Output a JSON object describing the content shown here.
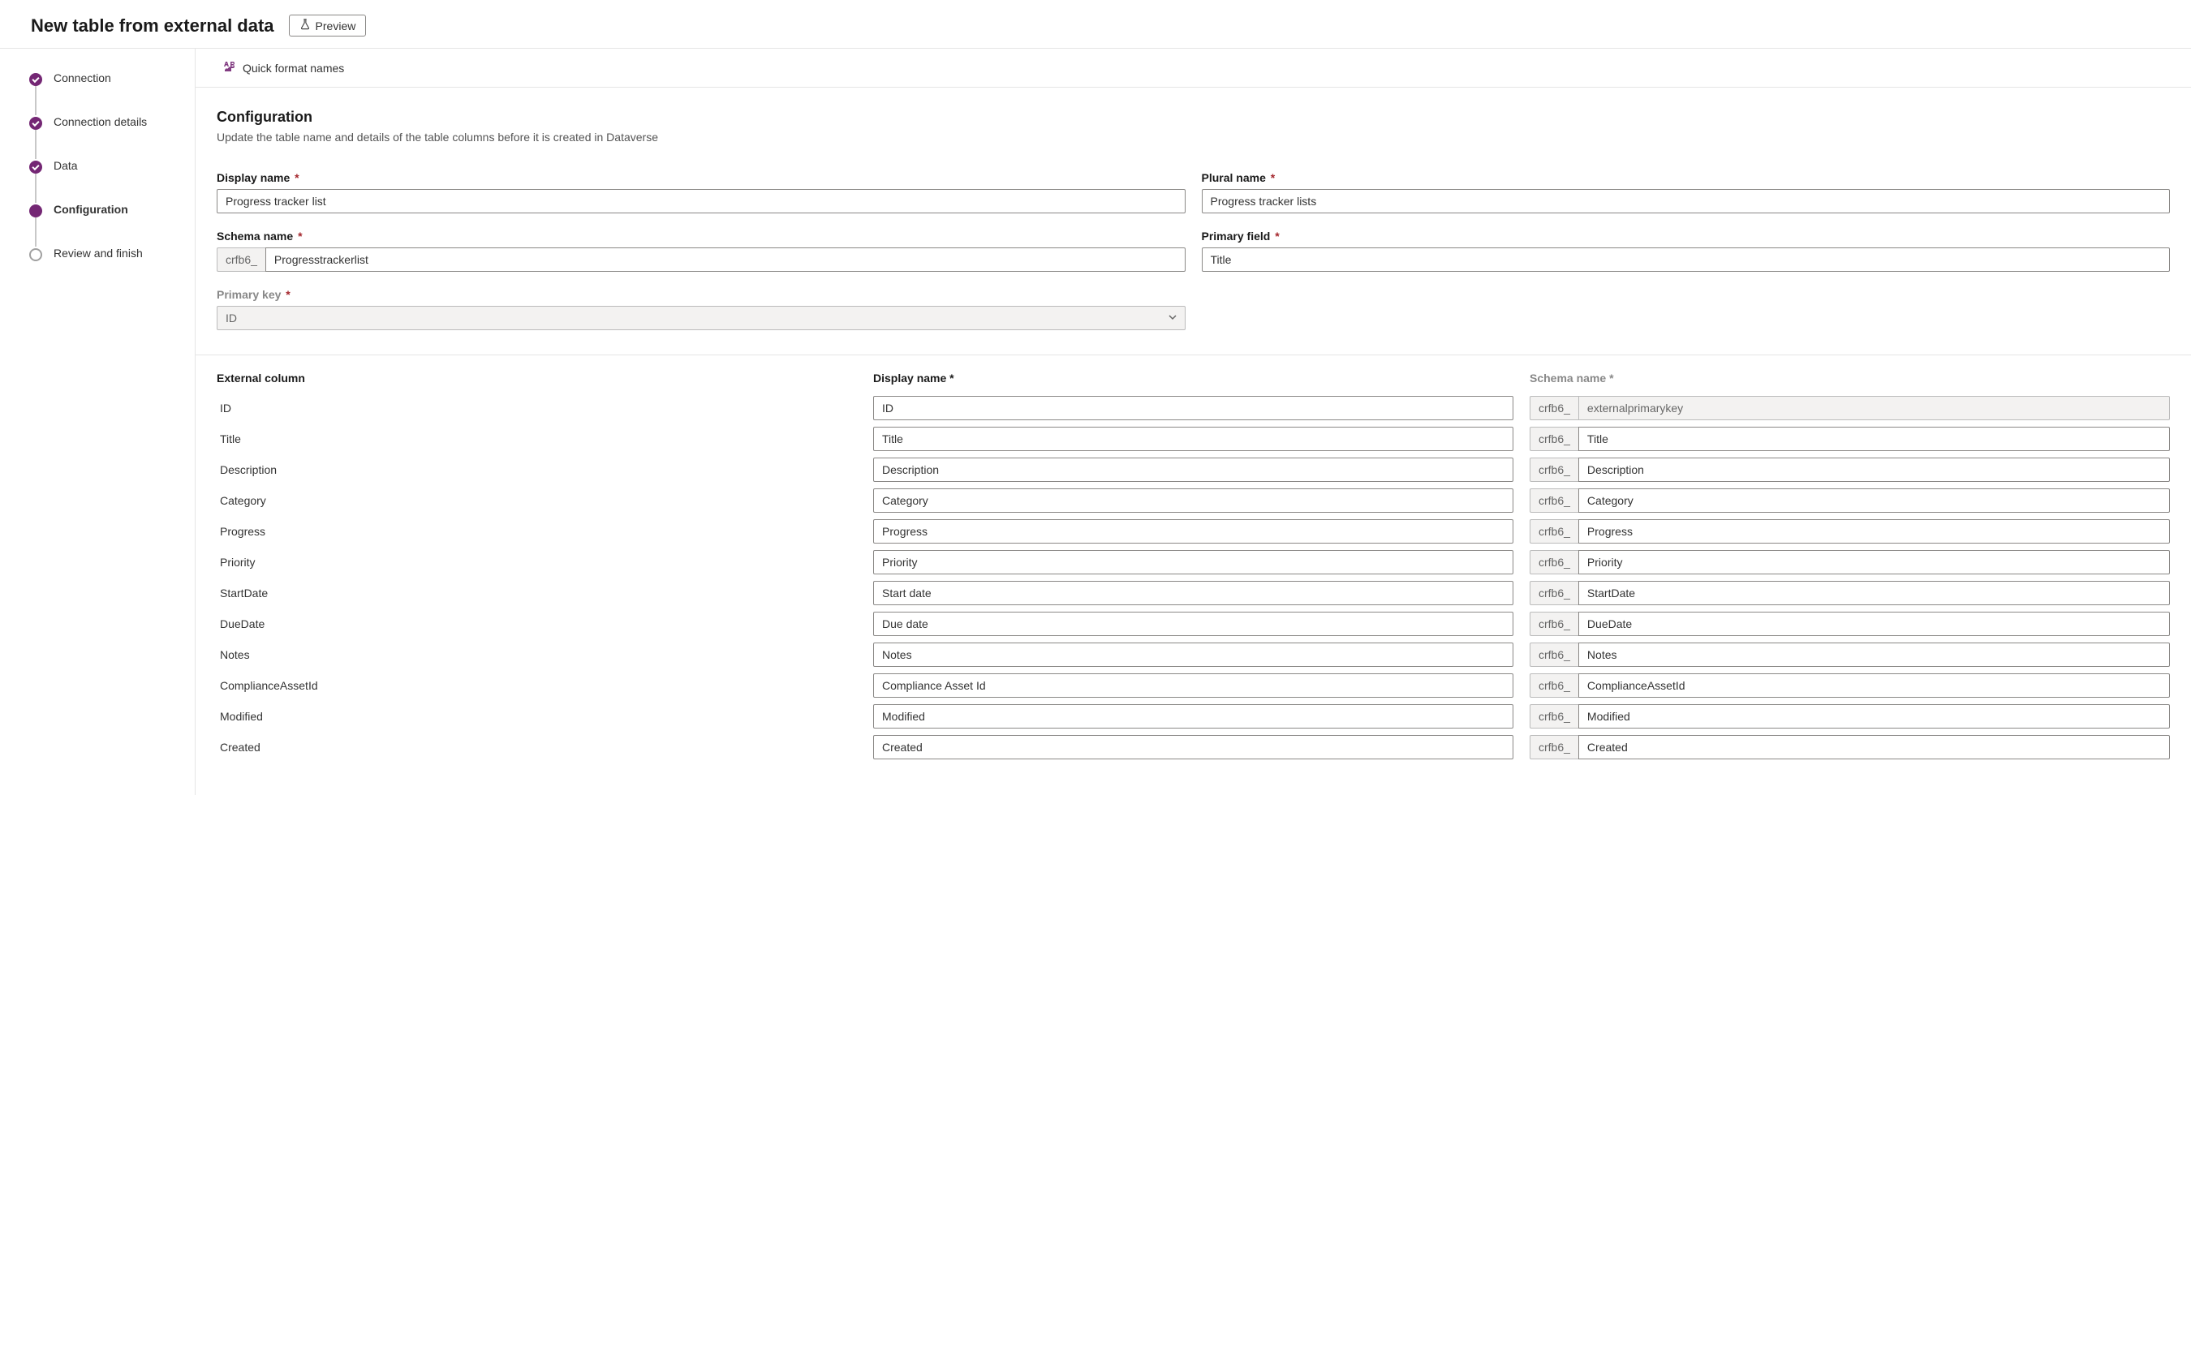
{
  "header": {
    "title": "New table from external data",
    "preview_label": "Preview"
  },
  "steps": [
    {
      "label": "Connection",
      "state": "completed"
    },
    {
      "label": "Connection details",
      "state": "completed"
    },
    {
      "label": "Data",
      "state": "completed"
    },
    {
      "label": "Configuration",
      "state": "current"
    },
    {
      "label": "Review and finish",
      "state": "upcoming"
    }
  ],
  "toolbar": {
    "quick_format_label": "Quick format names"
  },
  "config": {
    "section_title": "Configuration",
    "section_desc": "Update the table name and details of the table columns before it is created in Dataverse",
    "labels": {
      "display_name": "Display name",
      "plural_name": "Plural name",
      "schema_name": "Schema name",
      "primary_field": "Primary field",
      "primary_key": "Primary key"
    },
    "values": {
      "display_name": "Progress tracker list",
      "plural_name": "Progress tracker lists",
      "schema_prefix": "crfb6_",
      "schema_name": "Progresstrackerlist",
      "primary_field": "Title",
      "primary_key": "ID"
    }
  },
  "columns": {
    "headers": {
      "external": "External column",
      "display": "Display name",
      "schema": "Schema name"
    },
    "prefix": "crfb6_",
    "rows": [
      {
        "external": "ID",
        "display": "ID",
        "schema": "externalprimarykey",
        "schema_readonly": true
      },
      {
        "external": "Title",
        "display": "Title",
        "schema": "Title",
        "schema_readonly": false
      },
      {
        "external": "Description",
        "display": "Description",
        "schema": "Description",
        "schema_readonly": false
      },
      {
        "external": "Category",
        "display": "Category",
        "schema": "Category",
        "schema_readonly": false
      },
      {
        "external": "Progress",
        "display": "Progress",
        "schema": "Progress",
        "schema_readonly": false
      },
      {
        "external": "Priority",
        "display": "Priority",
        "schema": "Priority",
        "schema_readonly": false
      },
      {
        "external": "StartDate",
        "display": "Start date",
        "schema": "StartDate",
        "schema_readonly": false
      },
      {
        "external": "DueDate",
        "display": "Due date",
        "schema": "DueDate",
        "schema_readonly": false
      },
      {
        "external": "Notes",
        "display": "Notes",
        "schema": "Notes",
        "schema_readonly": false
      },
      {
        "external": "ComplianceAssetId",
        "display": "Compliance Asset Id",
        "schema": "ComplianceAssetId",
        "schema_readonly": false
      },
      {
        "external": "Modified",
        "display": "Modified",
        "schema": "Modified",
        "schema_readonly": false
      },
      {
        "external": "Created",
        "display": "Created",
        "schema": "Created",
        "schema_readonly": false
      }
    ]
  }
}
